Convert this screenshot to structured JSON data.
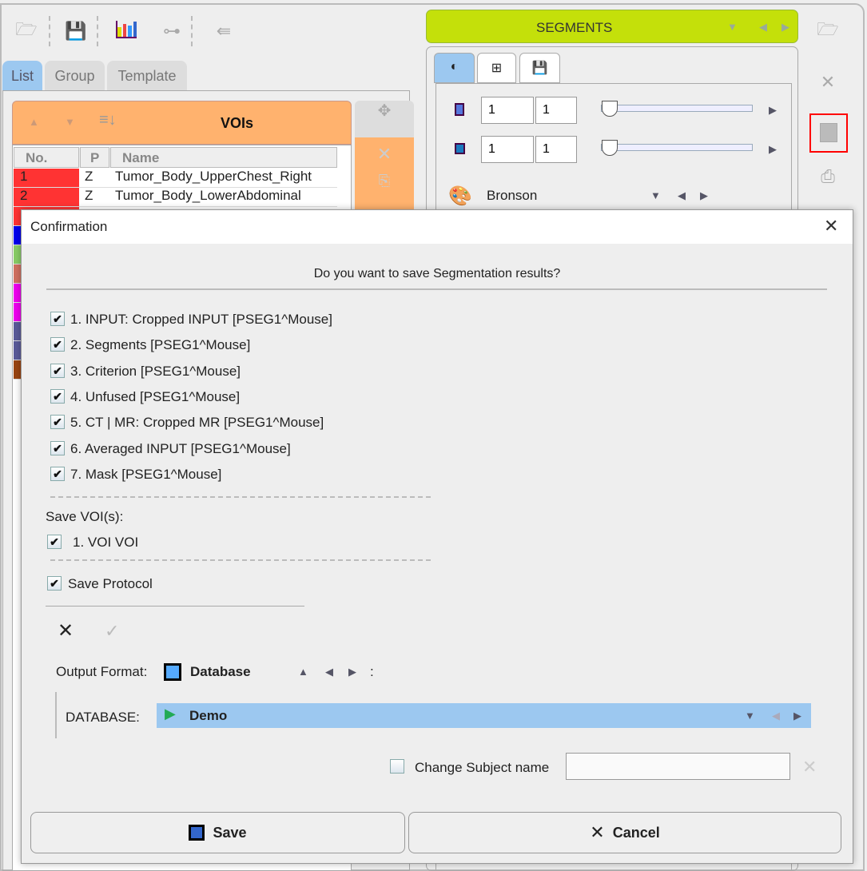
{
  "left_toolbar": {
    "icons": [
      "open-folder-icon",
      "save-icon",
      "chart-icon",
      "link-icon",
      "export-icon"
    ]
  },
  "tabs": [
    {
      "label": "List",
      "active": true
    },
    {
      "label": "Group"
    },
    {
      "label": "Template"
    }
  ],
  "voi_panel": {
    "title": "VOIs",
    "columns": [
      "No.",
      "P",
      "Name"
    ],
    "rows": [
      {
        "no": "1",
        "p": "Z",
        "name": "Tumor_Body_UpperChest_Right",
        "color": "#ff3333"
      },
      {
        "no": "2",
        "p": "Z",
        "name": "Tumor_Body_LowerAbdominal",
        "color": "#ff3333"
      },
      {
        "color": "#ff3333"
      },
      {
        "color": "#0000ee"
      },
      {
        "color": "#88cc66"
      },
      {
        "color": "#d07060"
      },
      {
        "color": "#ee00ee"
      },
      {
        "color": "#ee00ee"
      },
      {
        "color": "#5a5a99"
      },
      {
        "color": "#5a5a99"
      },
      {
        "color": "#994411"
      }
    ]
  },
  "segments": {
    "title": "SEGMENTS",
    "accent": "#c4e00a",
    "fields": [
      [
        "1",
        "1"
      ],
      [
        "1",
        "1"
      ]
    ],
    "colormap": "Bronson"
  },
  "dialog": {
    "title": "Confirmation",
    "question": "Do you want to save Segmentation results?",
    "items": [
      {
        "label": "1. INPUT: Cropped INPUT [PSEG1^Mouse]",
        "checked": true
      },
      {
        "label": "2. Segments [PSEG1^Mouse]",
        "checked": true
      },
      {
        "label": "3. Criterion [PSEG1^Mouse]",
        "checked": true
      },
      {
        "label": "4. Unfused [PSEG1^Mouse]",
        "checked": true
      },
      {
        "label": "5. CT | MR: Cropped MR [PSEG1^Mouse]",
        "checked": true
      },
      {
        "label": "6. Averaged INPUT [PSEG1^Mouse]",
        "checked": true
      },
      {
        "label": "7. Mask [PSEG1^Mouse]",
        "checked": true
      }
    ],
    "save_vois_label": "Save VOI(s):",
    "vois": [
      {
        "label": "1. VOI VOI",
        "checked": true
      }
    ],
    "save_protocol": {
      "label": "Save Protocol",
      "checked": true
    },
    "output_format_label": "Output Format:",
    "output_format": "Database",
    "colon": ":",
    "database_label": "DATABASE:",
    "database": "Demo",
    "change_subject": {
      "label": "Change Subject name",
      "checked": false,
      "value": ""
    },
    "save_label": "Save",
    "cancel_label": "Cancel",
    "check_mark": "✔"
  }
}
